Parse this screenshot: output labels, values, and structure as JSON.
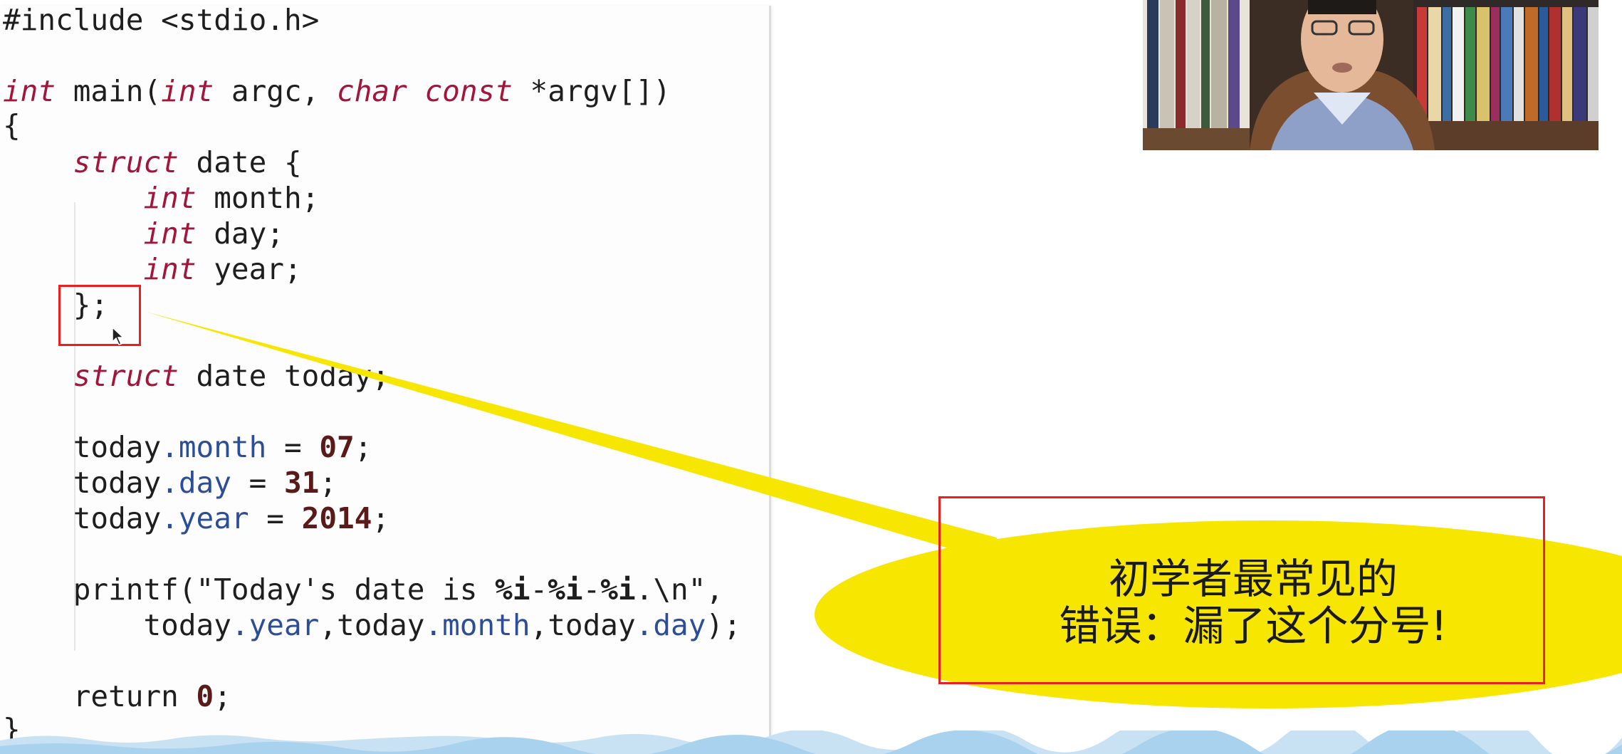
{
  "code": {
    "lines": [
      {
        "segments": [
          {
            "t": "#include <stdio.h>",
            "c": ""
          }
        ]
      },
      {
        "segments": [
          {
            "t": "int",
            "c": "kw"
          },
          {
            "t": " main(",
            "c": ""
          },
          {
            "t": "int",
            "c": "kw"
          },
          {
            "t": " argc, ",
            "c": ""
          },
          {
            "t": "char const",
            "c": "kw"
          },
          {
            "t": " *argv[])",
            "c": ""
          }
        ]
      },
      {
        "segments": [
          {
            "t": "{",
            "c": ""
          }
        ]
      },
      {
        "segments": [
          {
            "t": "    ",
            "c": ""
          },
          {
            "t": "struct",
            "c": "kw"
          },
          {
            "t": " date {",
            "c": ""
          }
        ]
      },
      {
        "segments": [
          {
            "t": "        ",
            "c": ""
          },
          {
            "t": "int",
            "c": "kw"
          },
          {
            "t": " month;",
            "c": ""
          }
        ]
      },
      {
        "segments": [
          {
            "t": "        ",
            "c": ""
          },
          {
            "t": "int",
            "c": "kw"
          },
          {
            "t": " day;",
            "c": ""
          }
        ]
      },
      {
        "segments": [
          {
            "t": "        ",
            "c": ""
          },
          {
            "t": "int",
            "c": "kw"
          },
          {
            "t": " year;",
            "c": ""
          }
        ]
      },
      {
        "segments": [
          {
            "t": "    };",
            "c": ""
          }
        ]
      },
      {
        "segments": [
          {
            "t": "",
            "c": ""
          }
        ]
      },
      {
        "segments": [
          {
            "t": "    ",
            "c": ""
          },
          {
            "t": "struct",
            "c": "kw"
          },
          {
            "t": " date today;",
            "c": ""
          }
        ]
      },
      {
        "segments": [
          {
            "t": "",
            "c": ""
          }
        ]
      },
      {
        "segments": [
          {
            "t": "    today",
            "c": ""
          },
          {
            "t": ".month",
            "c": "prop"
          },
          {
            "t": " = ",
            "c": ""
          },
          {
            "t": "07",
            "c": "num"
          },
          {
            "t": ";",
            "c": ""
          }
        ]
      },
      {
        "segments": [
          {
            "t": "    today",
            "c": ""
          },
          {
            "t": ".day",
            "c": "prop"
          },
          {
            "t": " = ",
            "c": ""
          },
          {
            "t": "31",
            "c": "num"
          },
          {
            "t": ";",
            "c": ""
          }
        ]
      },
      {
        "segments": [
          {
            "t": "    today",
            "c": ""
          },
          {
            "t": ".year",
            "c": "prop"
          },
          {
            "t": " = ",
            "c": ""
          },
          {
            "t": "2014",
            "c": "num"
          },
          {
            "t": ";",
            "c": ""
          }
        ]
      },
      {
        "segments": [
          {
            "t": "",
            "c": ""
          }
        ]
      },
      {
        "segments": [
          {
            "t": "    printf(\"Today's date is ",
            "c": ""
          },
          {
            "t": "%i",
            "c": "fmt"
          },
          {
            "t": "-",
            "c": ""
          },
          {
            "t": "%i",
            "c": "fmt"
          },
          {
            "t": "-",
            "c": ""
          },
          {
            "t": "%i",
            "c": "fmt"
          },
          {
            "t": ".\\n\",",
            "c": ""
          }
        ]
      },
      {
        "segments": [
          {
            "t": "        today",
            "c": ""
          },
          {
            "t": ".year",
            "c": "prop"
          },
          {
            "t": ",today",
            "c": ""
          },
          {
            "t": ".month",
            "c": "prop"
          },
          {
            "t": ",today",
            "c": ""
          },
          {
            "t": ".day",
            "c": "prop"
          },
          {
            "t": ");",
            "c": ""
          }
        ]
      },
      {
        "segments": [
          {
            "t": "",
            "c": ""
          }
        ]
      },
      {
        "segments": [
          {
            "t": "    return ",
            "c": ""
          },
          {
            "t": "0",
            "c": "num"
          },
          {
            "t": ";",
            "c": ""
          }
        ]
      },
      {
        "segments": [
          {
            "t": "}",
            "c": ""
          }
        ]
      }
    ]
  },
  "callout": {
    "line1": "初学者最常见的",
    "line2": "错误：漏了这个分号!"
  },
  "colors": {
    "keyword": "#a3153b",
    "property": "#2c4d98",
    "number": "#5b1a1a",
    "highlight_border": "#e8201f",
    "callout_fill": "#f7e600"
  },
  "icons": {
    "cursor": "mouse-pointer-icon"
  }
}
